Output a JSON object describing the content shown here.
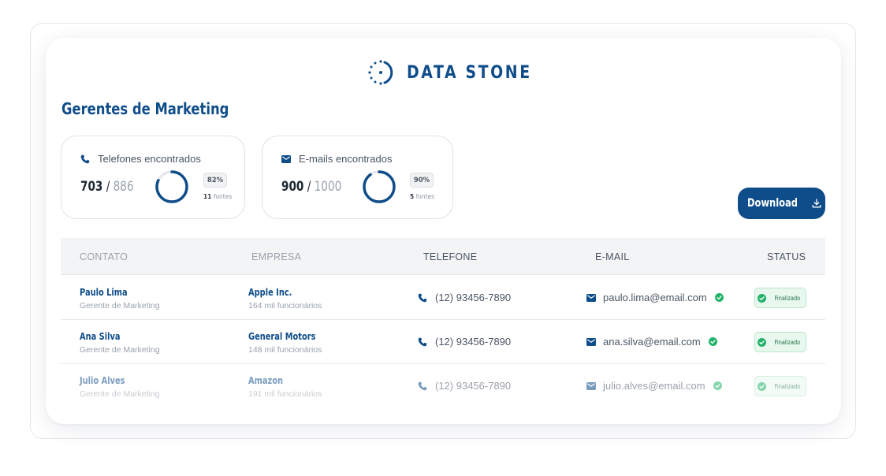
{
  "brand": {
    "name": "DATA STONE"
  },
  "page": {
    "title": "Gerentes de Marketing"
  },
  "colors": {
    "primary": "#0f4d8a",
    "success": "#22b36a",
    "muted": "#9aa2ab"
  },
  "stats": {
    "phones": {
      "label": "Telefones encontrados",
      "icon": "phone-icon",
      "found": "703",
      "separator": "/",
      "total": "886",
      "percent_label": "82%",
      "percent": 0.82,
      "sources_count": "11",
      "sources_label": "fontes"
    },
    "emails": {
      "label": "E-mails encontrados",
      "icon": "mail-icon",
      "found": "900",
      "separator": "/",
      "total": "1000",
      "percent_label": "90%",
      "percent": 0.9,
      "sources_count": "5",
      "sources_label": "fontes"
    }
  },
  "actions": {
    "download_label": "Download",
    "download_icon": "download-icon"
  },
  "table": {
    "headers": {
      "contact": "CONTATO",
      "company": "EMPRESA",
      "phone": "TELEFONE",
      "email": "E-MAIL",
      "status": "STATUS"
    },
    "rows": [
      {
        "name": "Paulo Lima",
        "role": "Gerente de Marketing",
        "company": "Apple Inc.",
        "employees": "164 mil funcionários",
        "phone": "(12) 93456-7890",
        "email": "paulo.lima@email.com",
        "status": "Finalizado"
      },
      {
        "name": "Ana Silva",
        "role": "Gerente de Marketing",
        "company": "General Motors",
        "employees": "148 mil funcionários",
        "phone": "(12) 93456-7890",
        "email": "ana.silva@email.com",
        "status": "Finalizado"
      },
      {
        "name": "Julio Alves",
        "role": "Gerente de Marketing",
        "company": "Amazon",
        "employees": "191 mil funcionários",
        "phone": "(12) 93456-7890",
        "email": "julio.alves@email.com",
        "status": "Finalizado"
      }
    ]
  }
}
